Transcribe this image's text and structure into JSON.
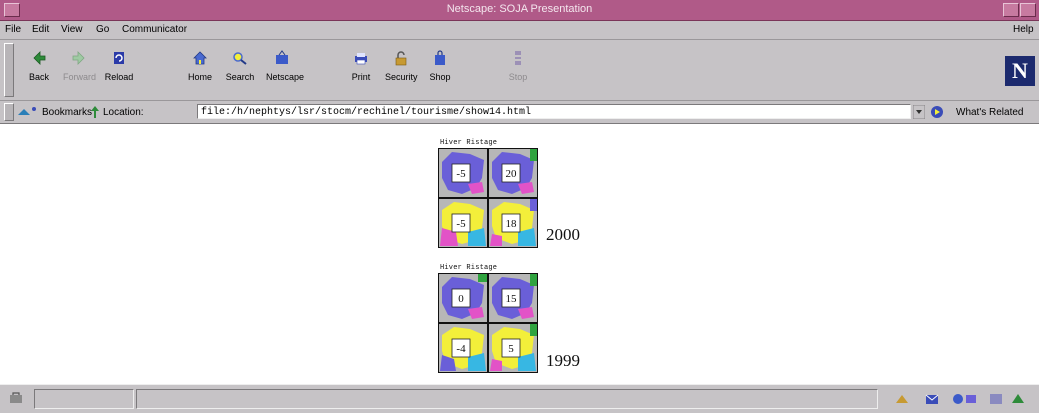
{
  "window": {
    "title": "Netscape: SOJA Presentation"
  },
  "menu": {
    "file": "File",
    "edit": "Edit",
    "view": "View",
    "go": "Go",
    "communicator": "Communicator",
    "help": "Help"
  },
  "toolbar": {
    "back": "Back",
    "forward": "Forward",
    "reload": "Reload",
    "home": "Home",
    "search": "Search",
    "netscape": "Netscape",
    "print": "Print",
    "security": "Security",
    "shop": "Shop",
    "stop": "Stop"
  },
  "location": {
    "bookmarks_label": "Bookmarks",
    "location_label": "Location:",
    "url": "file:/h/nephtys/lsr/stocm/rechinel/tourisme/show14.html",
    "whats_related": "What's Related"
  },
  "maps": [
    {
      "header": "Hiver  Ristage",
      "values": [
        "-5",
        "20",
        "-5",
        "18"
      ],
      "year": "2000"
    },
    {
      "header": "Hiver  Ristage",
      "values": [
        "0",
        "15",
        "-4",
        "5"
      ],
      "year": "1999"
    }
  ],
  "colors": {
    "titlebar": "#b05a88",
    "chrome": "#c6c3c6",
    "map_blue": "#6a5fd8",
    "map_yellow": "#f3ef3a",
    "map_magenta": "#e253c7",
    "map_cyan": "#37b7e3",
    "map_green": "#2fa33f"
  }
}
